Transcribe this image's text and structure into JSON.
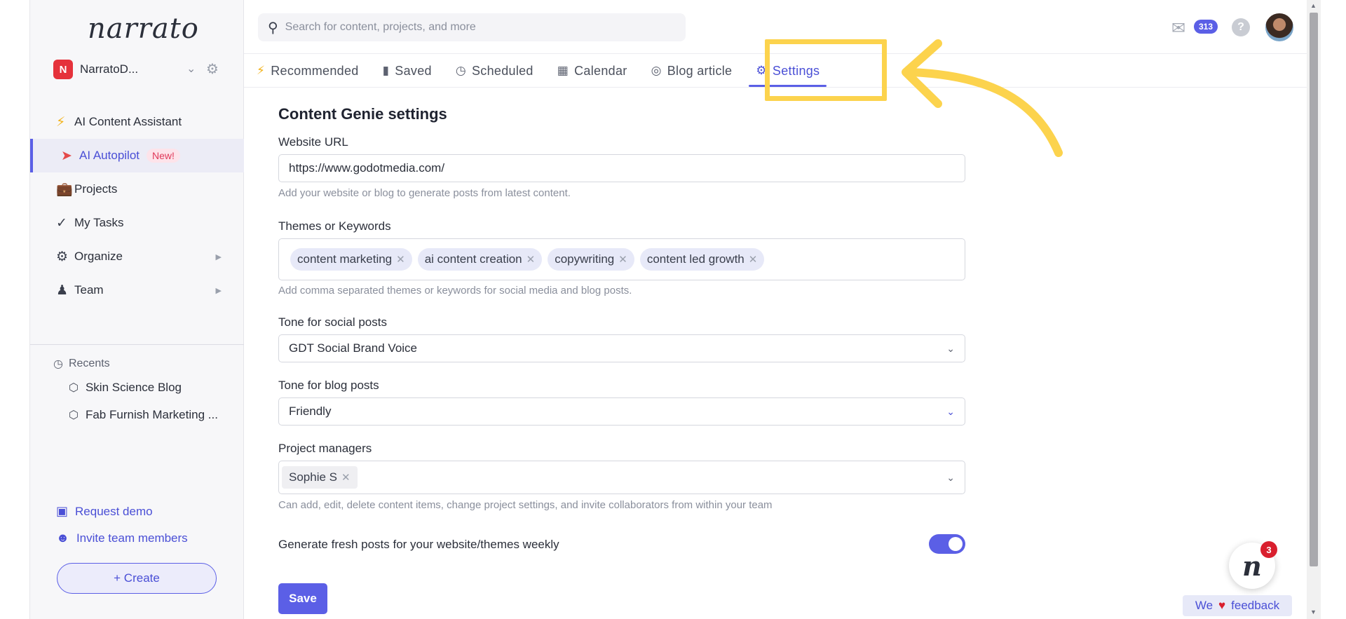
{
  "sidebar": {
    "logo": "narrato",
    "workspace": {
      "badge": "N",
      "name": "NarratoD..."
    },
    "nav": [
      {
        "label": "AI Content Assistant",
        "icon": "lightning-icon"
      },
      {
        "label": "AI Autopilot",
        "icon": "rocket-icon",
        "badge": "New!",
        "active": true
      },
      {
        "label": "Projects",
        "icon": "briefcase-icon"
      },
      {
        "label": "My Tasks",
        "icon": "checkmark-icon"
      },
      {
        "label": "Organize",
        "icon": "gears-icon",
        "expandable": true
      },
      {
        "label": "Team",
        "icon": "team-icon",
        "expandable": true
      }
    ],
    "recents_title": "Recents",
    "recents": [
      "Skin Science Blog",
      "Fab Furnish Marketing ..."
    ],
    "request_demo": "Request demo",
    "invite_team": "Invite team members",
    "create": "+ Create"
  },
  "topbar": {
    "search_placeholder": "Search for content, projects, and more",
    "mail_count": "313",
    "help": "?"
  },
  "tabs": [
    {
      "label": "Recommended",
      "icon": "lightning-icon"
    },
    {
      "label": "Saved",
      "icon": "bookmark-icon"
    },
    {
      "label": "Scheduled",
      "icon": "clock-icon"
    },
    {
      "label": "Calendar",
      "icon": "calendar-icon"
    },
    {
      "label": "Blog article",
      "icon": "rss-icon"
    },
    {
      "label": "Settings",
      "icon": "gear-icon",
      "active": true
    }
  ],
  "form": {
    "title": "Content Genie settings",
    "website_url": {
      "label": "Website URL",
      "value": "https://www.godotmedia.com/",
      "help": "Add your website or blog to generate posts from latest content."
    },
    "themes": {
      "label": "Themes or Keywords",
      "chips": [
        "content marketing",
        "ai content creation",
        "copywriting",
        "content led growth"
      ],
      "help": "Add comma separated themes or keywords for social media and blog posts."
    },
    "tone_social": {
      "label": "Tone for social posts",
      "value": "GDT Social Brand Voice"
    },
    "tone_blog": {
      "label": "Tone for blog posts",
      "value": "Friendly"
    },
    "project_managers": {
      "label": "Project managers",
      "chips": [
        "Sophie S"
      ],
      "help": "Can add, edit, delete content items, change project settings, and invite collaborators from within your team"
    },
    "weekly_toggle": {
      "label": "Generate fresh posts for your website/themes weekly",
      "on": true
    },
    "save": "Save"
  },
  "widgets": {
    "chat_badge": "3",
    "chat_logo": "n",
    "feedback_pre": "We",
    "feedback_post": "feedback"
  },
  "colors": {
    "accent": "#5b5fe6",
    "highlight": "#fcd34d",
    "danger": "#d91f2e"
  }
}
